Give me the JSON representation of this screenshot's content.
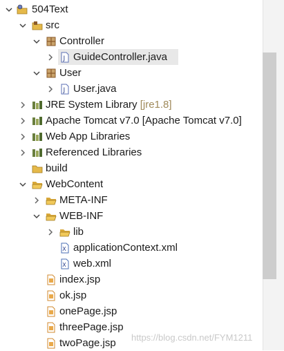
{
  "tree": {
    "project": "504Text",
    "src": "src",
    "pkg_controller": "Controller",
    "file_guide_controller": "GuideController.java",
    "pkg_user": "User",
    "file_user": "User.java",
    "jre": "JRE System Library ",
    "jre_suffix": "[jre1.8]",
    "tomcat": "Apache Tomcat v7.0 [Apache Tomcat v7.0]",
    "webapp_libs": "Web App Libraries",
    "ref_libs": "Referenced Libraries",
    "build": "build",
    "webcontent": "WebContent",
    "meta_inf": "META-INF",
    "web_inf": "WEB-INF",
    "lib": "lib",
    "app_context": "applicationContext.xml",
    "web_xml": "web.xml",
    "index_jsp": "index.jsp",
    "ok_jsp": "ok.jsp",
    "one_page": "onePage.jsp",
    "three_page": "threePage.jsp",
    "two_page": "twoPage.jsp"
  },
  "watermark": "https://blog.csdn.net/FYM1211",
  "colors": {
    "folder": "#e5b94a",
    "package": "#8a5a2a",
    "library": "#6a7f3f",
    "java_doc": "#5b6fb5",
    "xml": "#4b6fb5",
    "jsp": "#d08a2f"
  }
}
